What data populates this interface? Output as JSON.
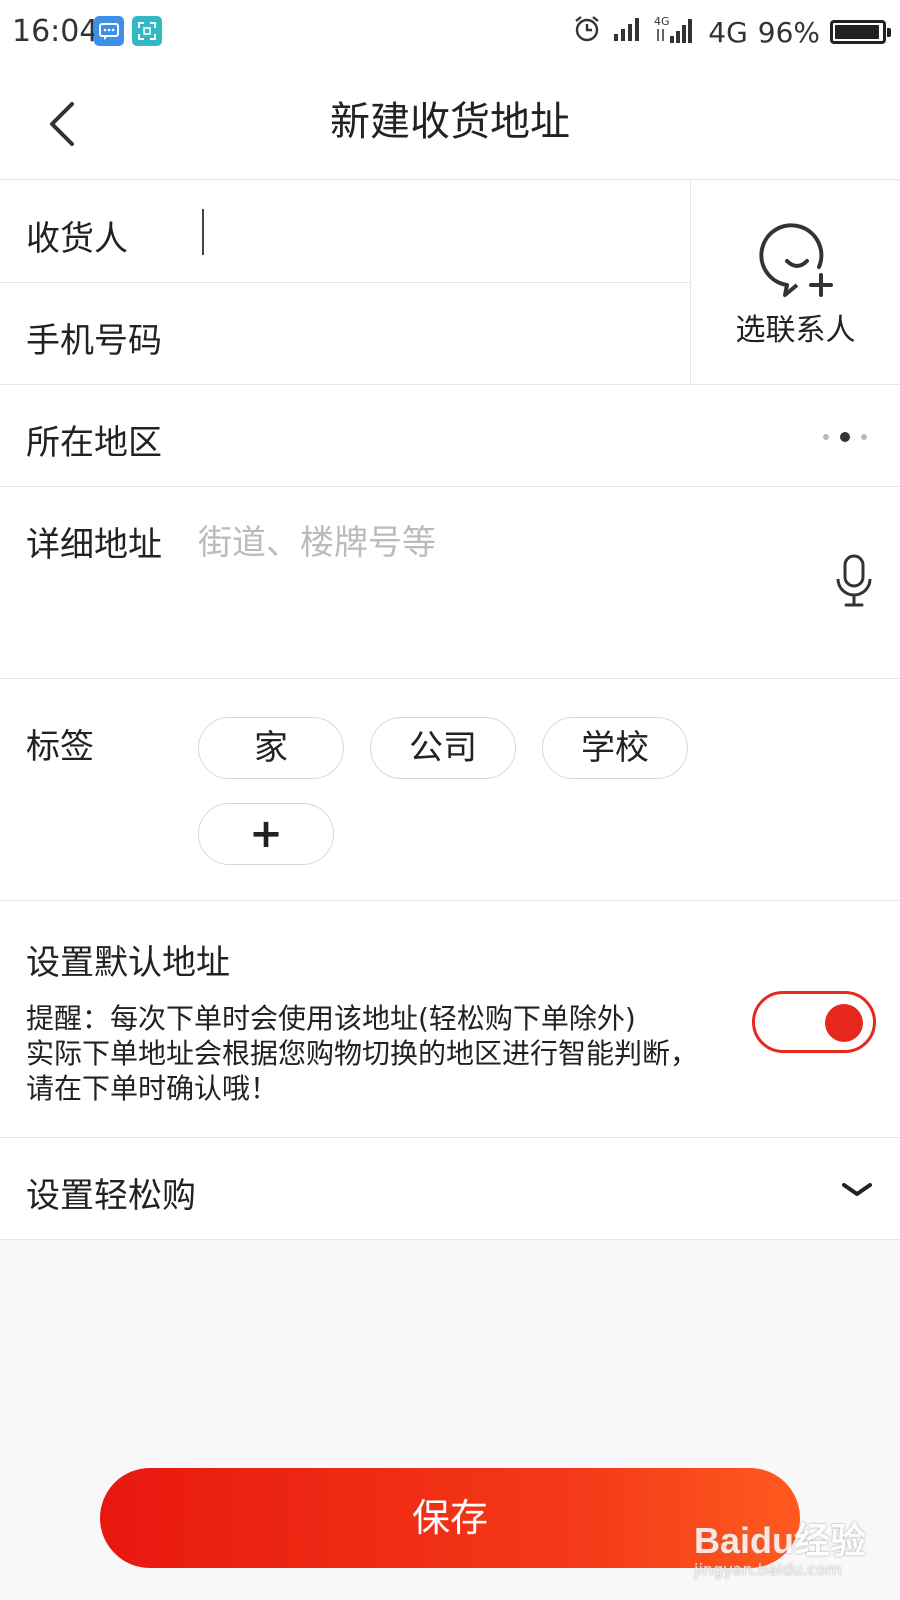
{
  "status_bar": {
    "time": "16:04",
    "network": "4G",
    "battery_percent": "96%",
    "battery_level": 0.96
  },
  "header": {
    "title": "新建收货地址"
  },
  "form": {
    "recipient_label": "收货人",
    "phone_label": "手机号码",
    "select_contact_label": "选联系人",
    "region_label": "所在地区",
    "detail_label": "详细地址",
    "detail_placeholder": "街道、楼牌号等",
    "tags_label": "标签",
    "tags": [
      "家",
      "公司",
      "学校"
    ],
    "add_tag": "+",
    "default_title": "设置默认地址",
    "default_hint_lines": [
      "提醒：每次下单时会使用该地址(轻松购下单除外)",
      "实际下单地址会根据您购物切换的地区进行智能判断，",
      "请在下单时确认哦！"
    ],
    "default_enabled": true,
    "easy_buy_label": "设置轻松购"
  },
  "footer": {
    "save_label": "保存"
  },
  "watermark": {
    "main": "Baidu经验",
    "sub": "jingyan.baidu.com"
  },
  "colors": {
    "accent": "#e8281f",
    "background": "#f8f8fb"
  }
}
